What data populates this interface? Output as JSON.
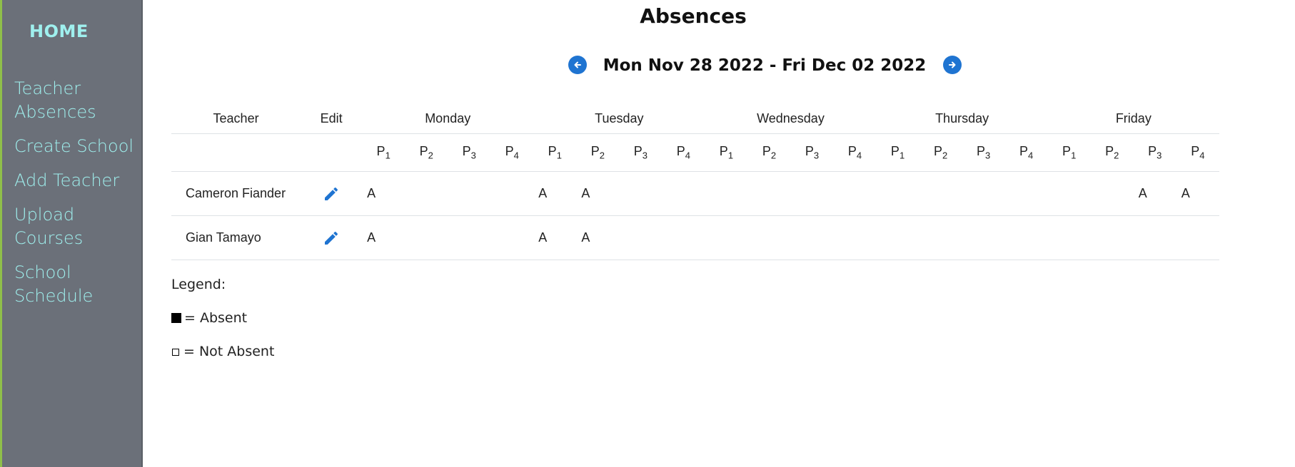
{
  "sidebar": {
    "home_label": "HOME",
    "items": [
      {
        "label": "Teacher Absences"
      },
      {
        "label": "Create School"
      },
      {
        "label": "Add Teacher"
      },
      {
        "label": "Upload Courses"
      },
      {
        "label": "School Schedule"
      }
    ]
  },
  "page": {
    "title": "Absences",
    "week_range": "Mon Nov 28 2022 - Fri Dec 02 2022",
    "prev_icon": "arrow-left-circle-icon",
    "next_icon": "arrow-right-circle-icon"
  },
  "table": {
    "headers": {
      "teacher": "Teacher",
      "edit": "Edit"
    },
    "days": [
      "Monday",
      "Tuesday",
      "Wednesday",
      "Thursday",
      "Friday"
    ],
    "period_prefix": "P",
    "periods": [
      "1",
      "2",
      "3",
      "4"
    ],
    "rows": [
      {
        "teacher": "Cameron Fiander",
        "cells": [
          "A",
          "",
          "",
          "",
          "A",
          "A",
          "",
          "",
          "",
          "",
          "",
          "",
          "",
          "",
          "",
          "",
          "",
          "",
          "A",
          "A"
        ]
      },
      {
        "teacher": "Gian Tamayo",
        "cells": [
          "A",
          "",
          "",
          "",
          "A",
          "A",
          "",
          "",
          "",
          "",
          "",
          "",
          "",
          "",
          "",
          "",
          "",
          "",
          "",
          ""
        ]
      }
    ],
    "edit_icon": "pencil-icon"
  },
  "legend": {
    "title": "Legend:",
    "absent": "= Absent",
    "not_absent": "= Not Absent"
  },
  "colors": {
    "sidebar_bg": "#6b7079",
    "sidebar_text": "#9ff0ee",
    "accent": "#1f74d1"
  }
}
